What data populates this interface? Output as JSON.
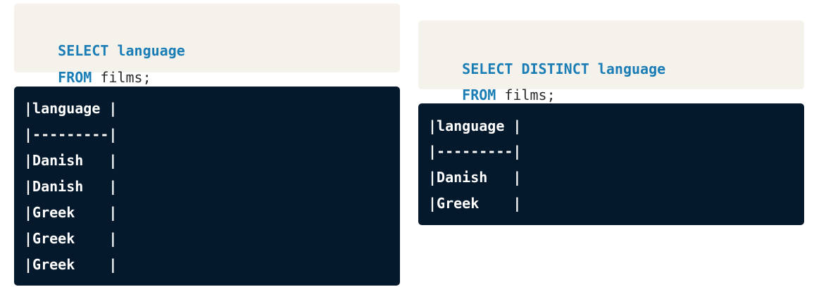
{
  "left_example": {
    "query": {
      "line1": {
        "keyword": "SELECT language",
        "rest": ""
      },
      "line2": {
        "keyword": "FROM",
        "rest": " films;"
      }
    },
    "result_rows": [
      "|language |",
      "|---------|",
      "|Danish   |",
      "|Danish   |",
      "|Greek    |",
      "|Greek    |",
      "|Greek    |"
    ]
  },
  "right_example": {
    "query": {
      "line1": {
        "keyword": "SELECT DISTINCT language",
        "rest": ""
      },
      "line2": {
        "keyword": "FROM",
        "rest": " films;"
      }
    },
    "result_rows": [
      "|language |",
      "|---------|",
      "|Danish   |",
      "|Greek    |"
    ]
  },
  "colors": {
    "code_background": "#f5f2eb",
    "keyword": "#1a7db6",
    "result_background": "#05192d",
    "result_text": "#ffffff"
  }
}
